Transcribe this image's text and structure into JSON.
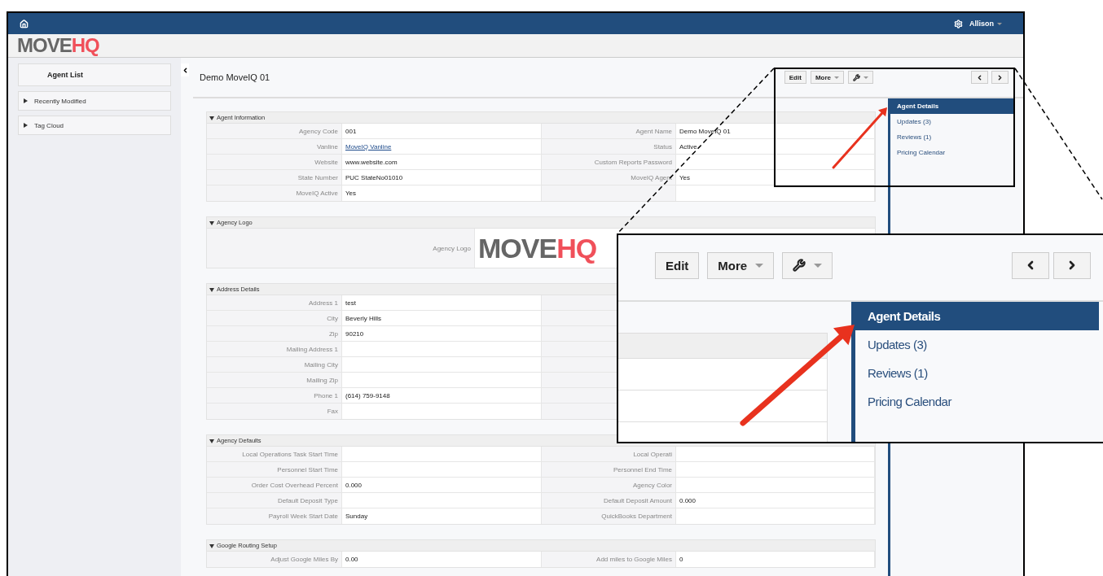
{
  "top_bar": {
    "user": "Allison"
  },
  "logo": {
    "part_1": "MOVE",
    "part_2": "HQ"
  },
  "sidebar": {
    "title": "Agent List",
    "items": [
      {
        "label": "Recently Modified",
        "expanded": false
      },
      {
        "label": "Tag Cloud",
        "expanded": false
      }
    ]
  },
  "record_title": "Demo MoveIQ 01",
  "toolbar": {
    "buttons": [
      {
        "kind": "text",
        "label": "Edit"
      },
      {
        "kind": "dropdown",
        "label": "More"
      },
      {
        "kind": "tool"
      }
    ]
  },
  "side_nav": [
    {
      "label": "Agent Details",
      "selected": true
    },
    {
      "label": "Updates (3)",
      "selected": false
    },
    {
      "label": "Reviews (1)",
      "selected": false
    },
    {
      "label": "Pricing Calendar",
      "selected": false
    }
  ],
  "sections": [
    {
      "title": "Agent Information",
      "expanded": true,
      "kind": "fields",
      "rows": [
        {
          "left": {
            "label": "Agency Code",
            "value": "001"
          },
          "right": {
            "label": "Agent Name",
            "value": "Demo MoveIQ 01"
          }
        },
        {
          "left": {
            "label": "Vanline",
            "value": "MoveIQ Vanline",
            "kind": "link"
          },
          "right": {
            "label": "Status",
            "value": "Active"
          }
        },
        {
          "left": {
            "label": "Website",
            "value": "www.website.com"
          },
          "right": {
            "label": "Custom Reports Password"
          }
        },
        {
          "left": {
            "label": "State Number",
            "value": "PUC StateNo01010"
          },
          "right": {
            "label": "MoveIQ Agent",
            "value": "Yes"
          }
        },
        {
          "left": {
            "label": "MoveIQ Active",
            "value": "Yes"
          },
          "right": {}
        }
      ]
    },
    {
      "title": "Agency Logo",
      "expanded": true,
      "kind": "logo",
      "label": "Agency Logo",
      "logo": {
        "part_1": "MOVE",
        "part_2": "HQ"
      }
    },
    {
      "title": "Address Details",
      "expanded": true,
      "kind": "fields",
      "rows": [
        {
          "left": {
            "label": "Address 1",
            "value": "test"
          }
        },
        {
          "left": {
            "label": "City",
            "value": "Beverly Hills"
          }
        },
        {
          "left": {
            "label": "Zip",
            "value": "90210"
          }
        },
        {
          "left": {
            "label": "Mailing Address 1"
          }
        },
        {
          "left": {
            "label": "Mailing City"
          }
        },
        {
          "left": {
            "label": "Mailing Zip"
          }
        },
        {
          "left": {
            "label": "Phone 1",
            "value": "(614) 759-9148"
          }
        },
        {
          "left": {
            "label": "Fax"
          }
        }
      ]
    },
    {
      "title": "Agency Defaults",
      "expanded": true,
      "kind": "fields",
      "rows": [
        {
          "left": {
            "label": "Local Operations Task Start Time"
          },
          "right": {
            "label": "Local Operati"
          }
        },
        {
          "left": {
            "label": "Personnel Start Time"
          },
          "right": {
            "label": "Personnel End Time"
          }
        },
        {
          "left": {
            "label": "Order Cost Overhead Percent",
            "value": "0.000"
          },
          "right": {
            "label": "Agency Color"
          }
        },
        {
          "left": {
            "label": "Default Deposit Type"
          },
          "right": {
            "label": "Default Deposit Amount",
            "value": "0.000"
          }
        },
        {
          "left": {
            "label": "Payroll Week Start Date",
            "value": "Sunday"
          },
          "right": {
            "label": "QuickBooks Department"
          }
        }
      ]
    },
    {
      "title": "Google Routing Setup",
      "expanded": true,
      "kind": "fields",
      "rows": [
        {
          "left": {
            "label": "Adjust Google Miles By",
            "value": "0.00"
          },
          "right": {
            "label": "Add miles to Google Miles",
            "value": "0"
          }
        }
      ]
    }
  ],
  "callout": {
    "buttons": [
      {
        "kind": "text",
        "label": "Edit"
      },
      {
        "kind": "dropdown",
        "label": "More"
      },
      {
        "kind": "tool"
      }
    ],
    "side_nav": [
      {
        "label": "Agent Details",
        "selected": true
      },
      {
        "label": "Updates (3)",
        "selected": false
      },
      {
        "label": "Reviews (1)",
        "selected": false
      },
      {
        "label": "Pricing Calendar",
        "selected": false
      }
    ]
  }
}
